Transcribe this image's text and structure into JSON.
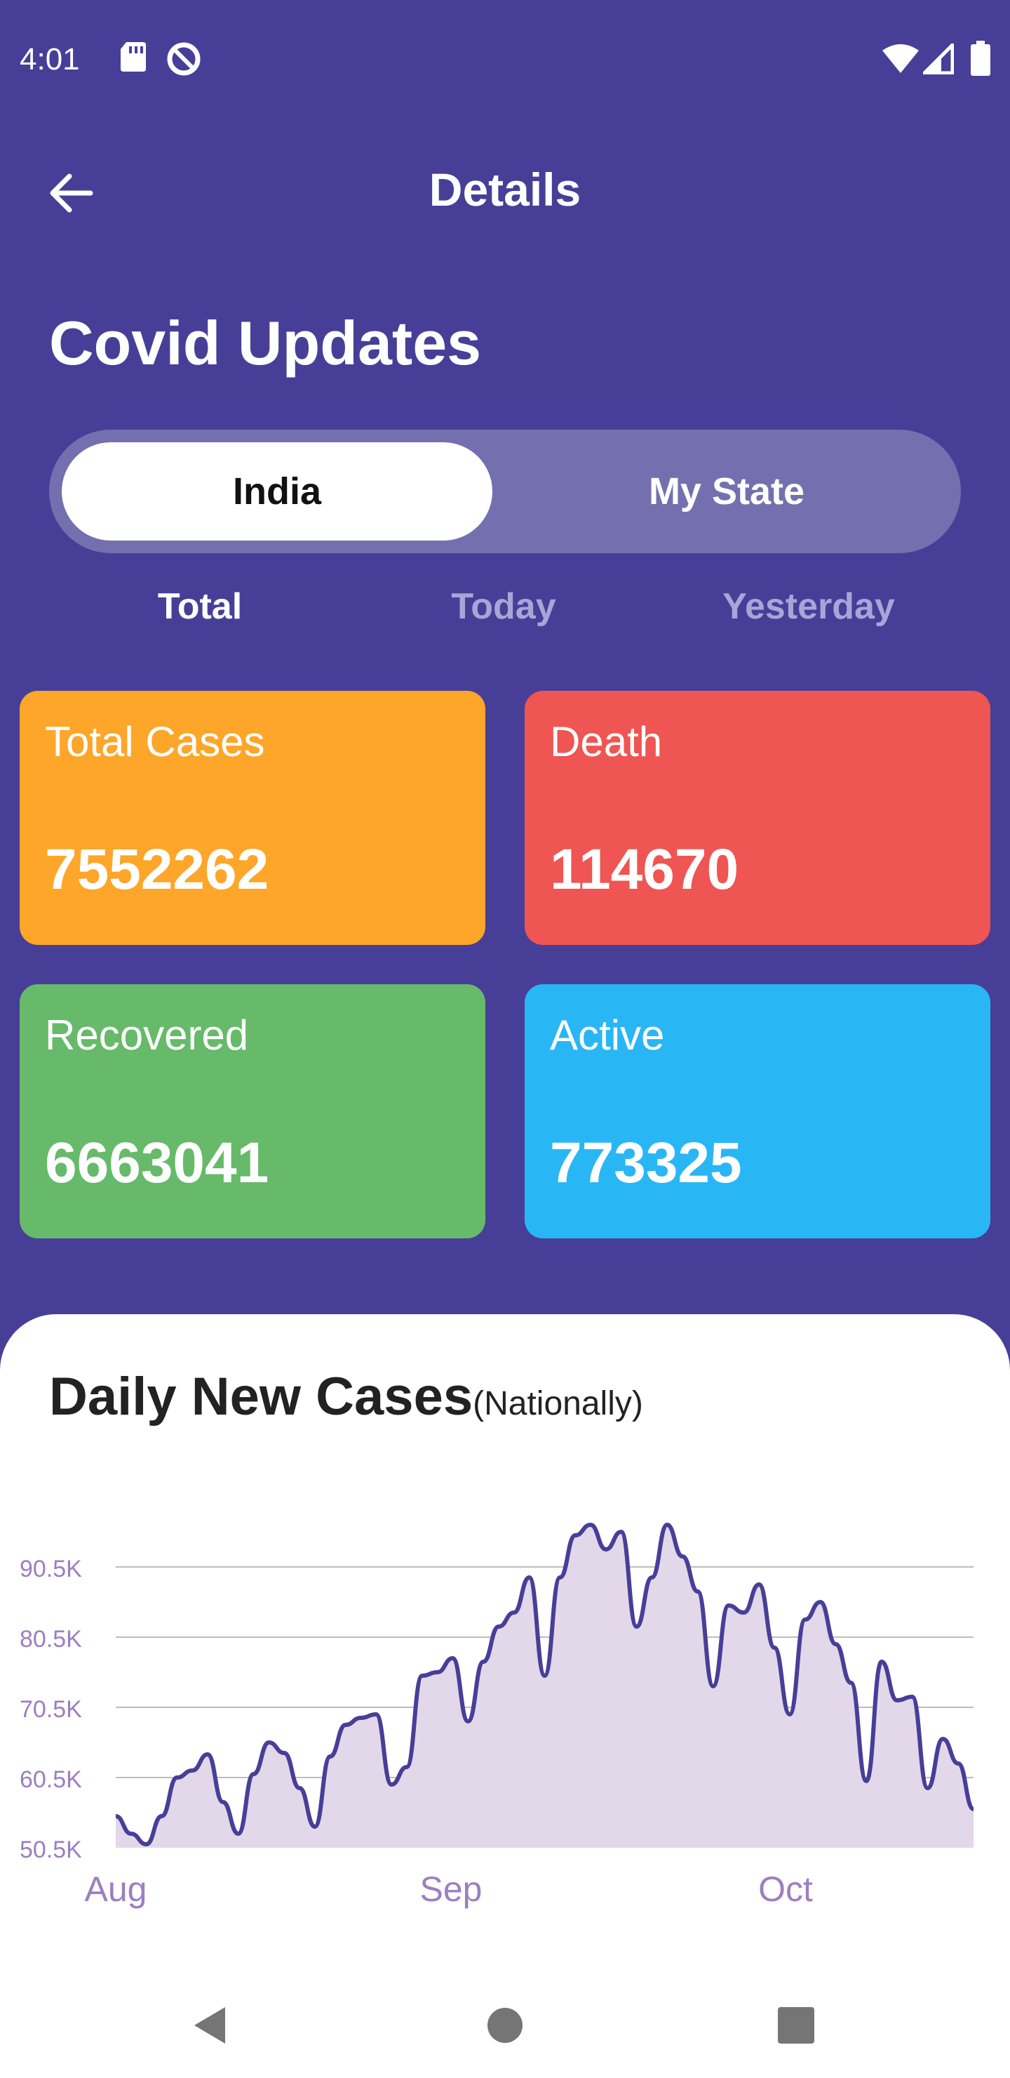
{
  "status_bar": {
    "time": "4:01",
    "left_icons": [
      "sd-card-icon",
      "data-saver-icon"
    ],
    "right_icons": [
      "wifi-icon",
      "signal-icon",
      "battery-icon"
    ]
  },
  "app_bar": {
    "back_icon": "arrow-left-icon",
    "title": "Details"
  },
  "heading": "Covid Updates",
  "region_toggle": {
    "options": [
      "India",
      "My State"
    ],
    "selected": "India"
  },
  "period_tabs": {
    "items": [
      "Total",
      "Today",
      "Yesterday"
    ],
    "selected": "Total"
  },
  "stats": {
    "total": {
      "label": "Total Cases",
      "value": "7552262",
      "color": "#fda629"
    },
    "death": {
      "label": "Death",
      "value": "114670",
      "color": "#ef5552"
    },
    "recovered": {
      "label": "Recovered",
      "value": "6663041",
      "color": "#66ba69"
    },
    "active": {
      "label": "Active",
      "value": "773325",
      "color": "#29b6f5"
    }
  },
  "chart": {
    "title": "Daily New Cases",
    "subtitle": "(Nationally)"
  },
  "chart_data": {
    "type": "area",
    "title": "Daily New Cases",
    "subtitle": "(Nationally)",
    "xlabel": "",
    "ylabel": "",
    "y_ticks": [
      "50.5K",
      "60.5K",
      "70.5K",
      "80.5K",
      "90.5K"
    ],
    "x_ticks": [
      "Aug",
      "Sep",
      "Oct"
    ],
    "ylim": [
      50500,
      100000
    ],
    "grid": true,
    "line_color": "#473f97",
    "fill_color": "#e2d8ea",
    "values": [
      55000,
      52500,
      51000,
      55000,
      60500,
      61500,
      63800,
      57000,
      52500,
      61000,
      65500,
      64000,
      59000,
      53500,
      63500,
      68000,
      69000,
      69500,
      59500,
      62000,
      75000,
      75500,
      77500,
      68500,
      77000,
      82000,
      84000,
      89000,
      75000,
      89000,
      95000,
      96500,
      93000,
      95500,
      82000,
      89000,
      96500,
      92000,
      87000,
      73500,
      85000,
      84000,
      88000,
      79000,
      69500,
      83000,
      85500,
      79500,
      74000,
      60000,
      77000,
      71500,
      72000,
      59000,
      66000,
      62500,
      56000
    ]
  },
  "nav_bar": {
    "buttons": [
      "back-triangle-icon",
      "home-circle-icon",
      "recents-square-icon"
    ]
  }
}
